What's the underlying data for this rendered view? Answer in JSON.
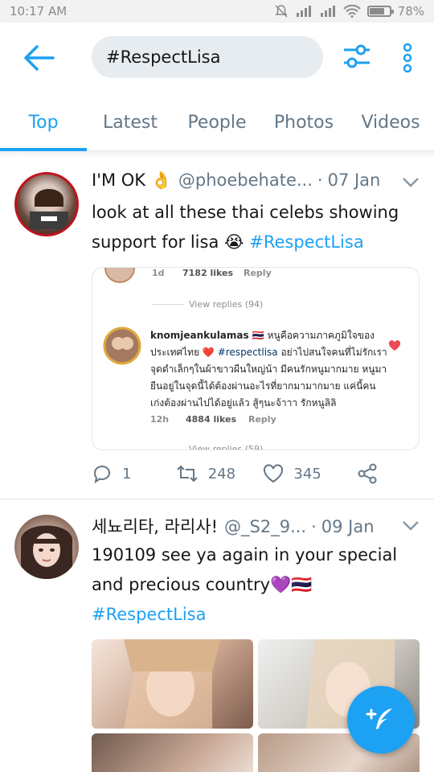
{
  "status_bar": {
    "time": "10:17 AM",
    "battery": "78%",
    "battery_level": 0.78
  },
  "search": {
    "query": "#RespectLisa"
  },
  "tabs": [
    {
      "label": "Top",
      "active": true
    },
    {
      "label": "Latest",
      "active": false
    },
    {
      "label": "People",
      "active": false
    },
    {
      "label": "Photos",
      "active": false
    },
    {
      "label": "Videos",
      "active": false
    }
  ],
  "tweets": [
    {
      "name": "I'M OK 👌",
      "handle": "@phoebehate...",
      "separator": "·",
      "date": "07 Jan",
      "text": "look at all these thai celebs showing support for lisa 😭 ",
      "hashtag": "#RespectLisa",
      "replies": "1",
      "retweets": "248",
      "likes": "345",
      "card": {
        "top_time": "1d",
        "top_likes": "7182 likes",
        "top_reply": "Reply",
        "view_replies_1": "View replies (94)",
        "commenter": "knomjeankulamas 🇹🇭",
        "comment_text": "หนูคือความภาคภูมิใจของประเทศไทย ❤️",
        "comment_hashtag": "#respectlisa",
        "comment_text_2": "อย่าไปสนใจคนที่ไม่รักเรา จุดดำเล็กๆในผ้าขาวผืนใหญ่น้า มีคนรักหนูมากมาย หนูมายืนอยู่ในจุดนี้ได้ต้องผ่านอะไรที่ยากมามากมาย แค่นี้คนเก่งต้องผ่านไปได้อยู่แล้ว สู้ๆนะจ้าาา รักหนูลิลิ",
        "comment_time": "12h",
        "comment_likes": "4884 likes",
        "comment_reply": "Reply",
        "view_replies_2": "View replies (59)"
      }
    },
    {
      "name": "세뇨리타, 라리사!",
      "handle": "@_S2_9...",
      "separator": "·",
      "date": "09 Jan",
      "text": "190109 see ya again in your special and precious country💜🇹🇭",
      "hashtag": "#RespectLisa"
    }
  ]
}
